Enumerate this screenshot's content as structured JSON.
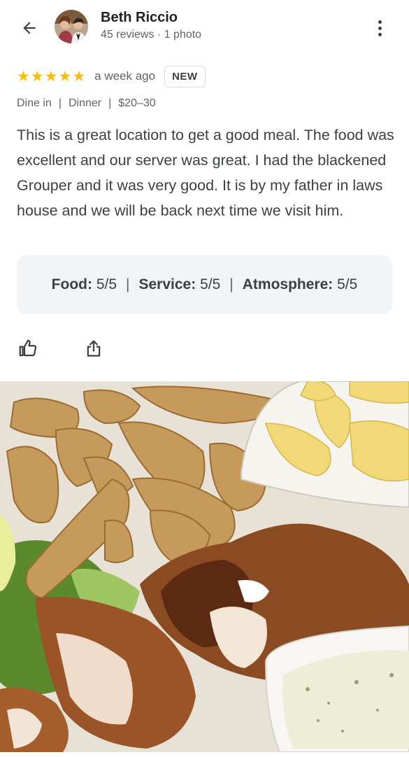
{
  "reviewer": {
    "name": "Beth Riccio",
    "meta": "45 reviews · 1 photo"
  },
  "review": {
    "stars": 5,
    "time": "a week ago",
    "badge": "NEW",
    "tags": [
      "Dine in",
      "Dinner",
      "$20–30"
    ],
    "text": "This is a great location to get a good meal. The food was excellent and our server was great. I had the blackened Grouper and it was very good. It is by my father in laws house and we will be back next time we visit him."
  },
  "scores": [
    {
      "label": "Food:",
      "value": "5/5"
    },
    {
      "label": "Service:",
      "value": "5/5"
    },
    {
      "label": "Atmosphere:",
      "value": "5/5"
    }
  ],
  "colors": {
    "star": "#fbbc04",
    "text": "#3c4043",
    "secondary": "#5f6368",
    "scores_bg": "#f1f3f4"
  },
  "icons": {
    "back": "arrow-back-icon",
    "more": "more-vert-icon",
    "like": "thumb-up-icon",
    "share": "share-icon"
  }
}
